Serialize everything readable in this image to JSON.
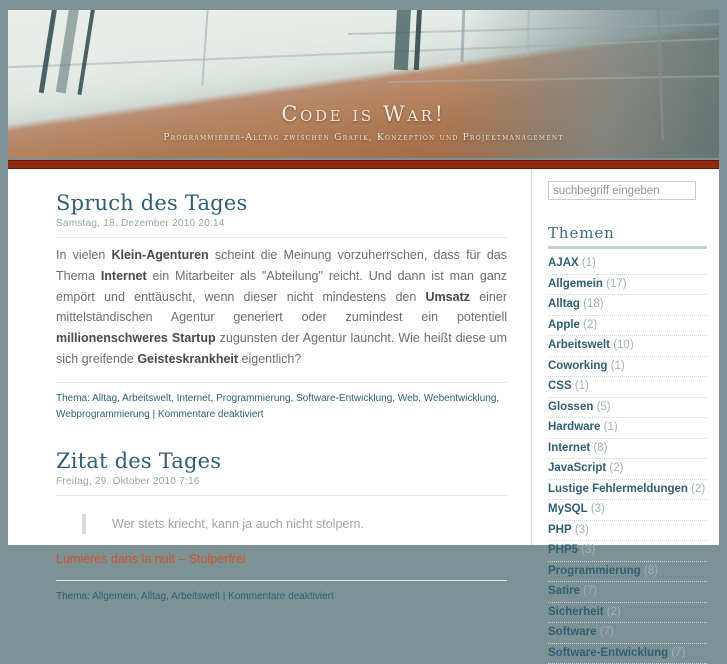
{
  "site": {
    "title": "Code is War!",
    "tagline": "Programmierer-Alltag zwischen Grafik, Konzeption und Projektmanagement"
  },
  "colors": {
    "page_background": "#7d9295",
    "accent_bar": "#8e2b10",
    "heading": "#2e5f72",
    "link": "#2e5f72",
    "quote_link": "#d1542a",
    "muted_text": "#93a6a9"
  },
  "posts": [
    {
      "title": "Spruch des Tages",
      "date": "Samstag, 18. Dezember 2010 20:14",
      "body_html": "In vielen <b>Klein-Agenturen</b> scheint die Meinung vorzuherrschen, dass für das Thema <b>Internet</b> ein Mitarbeiter als \"Abteilung\" reicht. Und dann ist man ganz empört und enttäuscht, wenn dieser nicht mindestens den <b>Umsatz</b> einer mittelständischen Agentur generiert oder zumindest ein potentiell <b>millionenschweres Startup</b> zugunsten der Agentur launcht. Wie heißt diese um sich greifende <b>Geisteskrankheit</b> eigentlich?",
      "meta": "Thema: Alltag, Arbeitswelt, Internet, Programmierung, Software-Entwicklung, Web, Webentwicklung, Webprogrammierung | Kommentare deaktiviert"
    },
    {
      "title": "Zitat des Tages",
      "date": "Freitag, 29. Oktober 2010 7:16",
      "quote": "Wer stets kriecht, kann ja auch nicht stolpern.",
      "quote_source": "Lumières dans la nuit – Stolperfrei",
      "meta": "Thema: Allgemein, Alltag, Arbeitswelt | Kommentare deaktiviert"
    }
  ],
  "sidebar": {
    "search": {
      "placeholder": "suchbegriff eingeben",
      "value": ""
    },
    "categories_title": "Themen",
    "categories": [
      {
        "label": "AJAX",
        "count": "(1)"
      },
      {
        "label": "Allgemein",
        "count": "(17)"
      },
      {
        "label": "Alltag",
        "count": "(18)"
      },
      {
        "label": "Apple",
        "count": "(2)"
      },
      {
        "label": "Arbeitswelt",
        "count": "(10)"
      },
      {
        "label": "Coworking",
        "count": "(1)"
      },
      {
        "label": "CSS",
        "count": "(1)"
      },
      {
        "label": "Glossen",
        "count": "(5)"
      },
      {
        "label": "Hardware",
        "count": "(1)"
      },
      {
        "label": "Internet",
        "count": "(8)"
      },
      {
        "label": "JavaScript",
        "count": "(2)"
      },
      {
        "label": "Lustige Fehlermeldungen",
        "count": "(2)"
      },
      {
        "label": "MySQL",
        "count": "(3)"
      },
      {
        "label": "PHP",
        "count": "(3)"
      },
      {
        "label": "PHP5",
        "count": "(3)"
      },
      {
        "label": "Programmierung",
        "count": "(8)"
      },
      {
        "label": "Satire",
        "count": "(7)"
      },
      {
        "label": "Sicherheit",
        "count": "(2)"
      },
      {
        "label": "Software",
        "count": "(7)"
      },
      {
        "label": "Software-Entwicklung",
        "count": "(7)"
      }
    ]
  }
}
